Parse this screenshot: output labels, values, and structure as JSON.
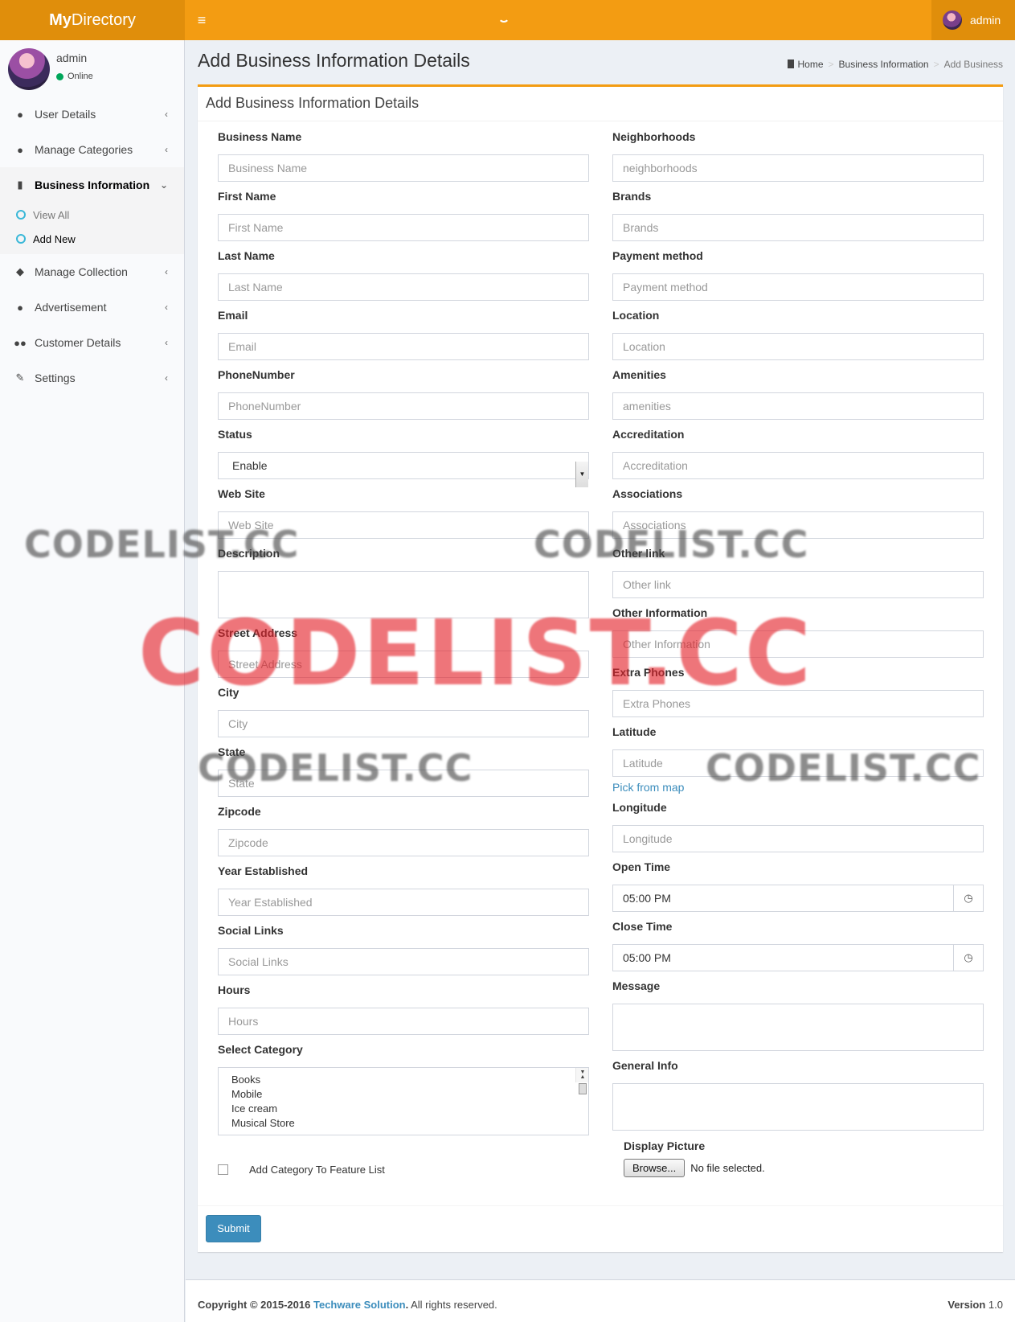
{
  "header": {
    "logo_bold": "My",
    "logo_rest": "Directory",
    "user_name": "admin"
  },
  "sidebar": {
    "user_name": "admin",
    "user_status": "Online",
    "items": [
      {
        "label": "User Details"
      },
      {
        "label": "Manage Categories"
      },
      {
        "label": "Business Information"
      },
      {
        "label": "Manage Collection"
      },
      {
        "label": "Advertisement"
      },
      {
        "label": "Customer Details"
      },
      {
        "label": "Settings"
      }
    ],
    "submenu": [
      {
        "label": "View All"
      },
      {
        "label": "Add New"
      }
    ]
  },
  "page": {
    "title": "Add Business Information Details",
    "breadcrumb": [
      "Home",
      "Business Information",
      "Add Business"
    ],
    "box_title": "Add Business Information Details"
  },
  "form": {
    "business_name": {
      "label": "Business Name",
      "placeholder": "Business Name"
    },
    "first_name": {
      "label": "First Name",
      "placeholder": "First Name"
    },
    "last_name": {
      "label": "Last Name",
      "placeholder": "Last Name"
    },
    "email": {
      "label": "Email",
      "placeholder": "Email"
    },
    "phone": {
      "label": "PhoneNumber",
      "placeholder": "PhoneNumber"
    },
    "status": {
      "label": "Status",
      "value": "Enable"
    },
    "website": {
      "label": "Web Site",
      "placeholder": "Web Site"
    },
    "description": {
      "label": "Description"
    },
    "street": {
      "label": "Street Address",
      "placeholder": "Street Address"
    },
    "city": {
      "label": "City",
      "placeholder": "City"
    },
    "state": {
      "label": "State",
      "placeholder": "State"
    },
    "zipcode": {
      "label": "Zipcode",
      "placeholder": "Zipcode"
    },
    "year": {
      "label": "Year Established",
      "placeholder": "Year Established"
    },
    "social": {
      "label": "Social Links",
      "placeholder": "Social Links"
    },
    "hours": {
      "label": "Hours",
      "placeholder": "Hours"
    },
    "category": {
      "label": "Select Category",
      "options": [
        "Books",
        "Mobile",
        "Ice cream",
        "Musical Store"
      ]
    },
    "feature_label": "Add Category To Feature List",
    "neighborhoods": {
      "label": "Neighborhoods",
      "placeholder": "neighborhoods"
    },
    "brands": {
      "label": "Brands",
      "placeholder": "Brands"
    },
    "payment": {
      "label": "Payment method",
      "placeholder": "Payment method"
    },
    "location": {
      "label": "Location",
      "placeholder": "Location"
    },
    "amenities": {
      "label": "Amenities",
      "placeholder": "amenities"
    },
    "accreditation": {
      "label": "Accreditation",
      "placeholder": "Accreditation"
    },
    "associations": {
      "label": "Associations",
      "placeholder": "Associations"
    },
    "other_link": {
      "label": "Other link",
      "placeholder": "Other link"
    },
    "other_info": {
      "label": "Other Information",
      "placeholder": "Other Information"
    },
    "extra_phones": {
      "label": "Extra Phones",
      "placeholder": "Extra Phones"
    },
    "latitude": {
      "label": "Latitude",
      "placeholder": "Latitude",
      "pick": "Pick from map"
    },
    "longitude": {
      "label": "Longitude",
      "placeholder": "Longitude"
    },
    "open_time": {
      "label": "Open Time",
      "value": "05:00 PM"
    },
    "close_time": {
      "label": "Close Time",
      "value": "05:00 PM"
    },
    "message": {
      "label": "Message"
    },
    "general_info": {
      "label": "General Info"
    },
    "display_picture": {
      "label": "Display Picture",
      "button": "Browse...",
      "status": "No file selected."
    },
    "submit": "Submit"
  },
  "footer": {
    "copyright_prefix": "Copyright © 2015-2016",
    "company": "Techware Solution",
    "suffix": ". All rights reserved.",
    "version_label": "Version",
    "version": "1.0"
  },
  "watermark": "CODELIST.CC",
  "colors": {
    "accent": "#f39c12",
    "primary": "#3c8dbc",
    "online": "#00a65a"
  }
}
